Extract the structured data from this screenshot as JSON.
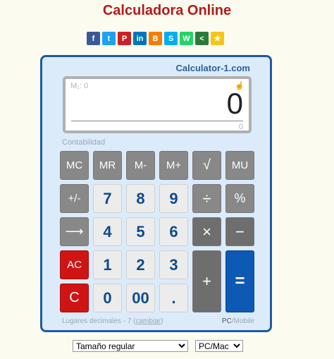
{
  "title": "Calculadora Online",
  "share": [
    {
      "icon": "facebook-icon",
      "glyph": "f",
      "color": "#3b5998"
    },
    {
      "icon": "twitter-icon",
      "glyph": "t",
      "color": "#1da1f2"
    },
    {
      "icon": "pinterest-icon",
      "glyph": "P",
      "color": "#cb2027"
    },
    {
      "icon": "linkedin-icon",
      "glyph": "in",
      "color": "#0077b5"
    },
    {
      "icon": "blogger-icon",
      "glyph": "B",
      "color": "#f57d00"
    },
    {
      "icon": "skype-icon",
      "glyph": "S",
      "color": "#00aff0"
    },
    {
      "icon": "whatsapp-icon",
      "glyph": "W",
      "color": "#25d366"
    },
    {
      "icon": "share-icon",
      "glyph": "<",
      "color": "#2c7a3b"
    },
    {
      "icon": "star-icon",
      "glyph": "★",
      "color": "#f5c518"
    }
  ],
  "brand": "Calculator-1.com",
  "display": {
    "memory": "M₁: 0",
    "value": "0",
    "secondary": "0"
  },
  "mode": "Contabilidad",
  "keys": {
    "mc": "MC",
    "mr": "MR",
    "m_minus": "M-",
    "m_plus": "M+",
    "sqrt": "√",
    "mu": "MU",
    "plus_minus": "+/-",
    "seven": "7",
    "eight": "8",
    "nine": "9",
    "divide": "÷",
    "percent": "%",
    "backspace": "⟶",
    "four": "4",
    "five": "5",
    "six": "6",
    "multiply": "×",
    "minus": "−",
    "ac": "AC",
    "one": "1",
    "two": "2",
    "three": "3",
    "plus": "+",
    "clear": "C",
    "zero": "0",
    "double_zero": "00",
    "dot": ".",
    "equals": "="
  },
  "footer": {
    "decimals": "Lugares decimales - 7 (",
    "change": "cambiar",
    "close": ")",
    "pc": "PC",
    "sep": "/",
    "mobile": "Mobile"
  },
  "size_select": {
    "selected": "Tamaño regular"
  },
  "platform_select": {
    "selected": "PC/Mac"
  },
  "colors": {
    "accent": "#1f5aa6",
    "title": "#b31b1b",
    "number": "#0e4a8c",
    "red": "#d01414",
    "blue": "#0e59b3"
  }
}
